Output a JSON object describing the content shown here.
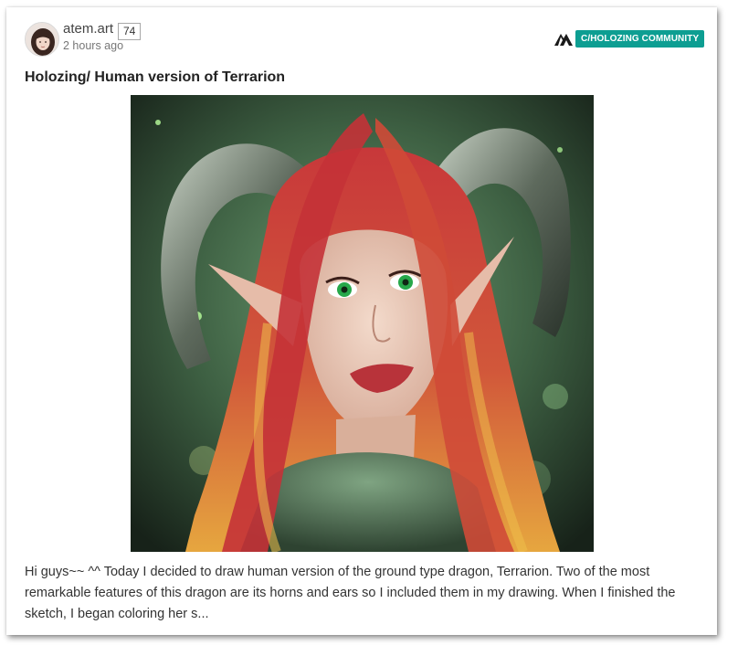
{
  "post": {
    "author": "atem.art",
    "reputation": "74",
    "time": "2 hours ago",
    "community": "C/HOLOZING COMMUNITY",
    "title": "Holozing/ Human version of Terrarion",
    "image_alt": "Digital painting of a red-haired woman with green eyes, elf ears and curled dragon horns",
    "excerpt": "Hi guys~~ ^^ Today I decided to draw human version of the ground type dragon, Terrarion. Two of the most remarkable features of this dragon are its horns and ears so I included them in my drawing. When I finished the sketch, I began coloring her s..."
  },
  "icons": {
    "community": "holozing-logo-icon",
    "avatar": "user-avatar"
  },
  "colors": {
    "community_tag": "#0d9e92",
    "text": "#333333"
  }
}
